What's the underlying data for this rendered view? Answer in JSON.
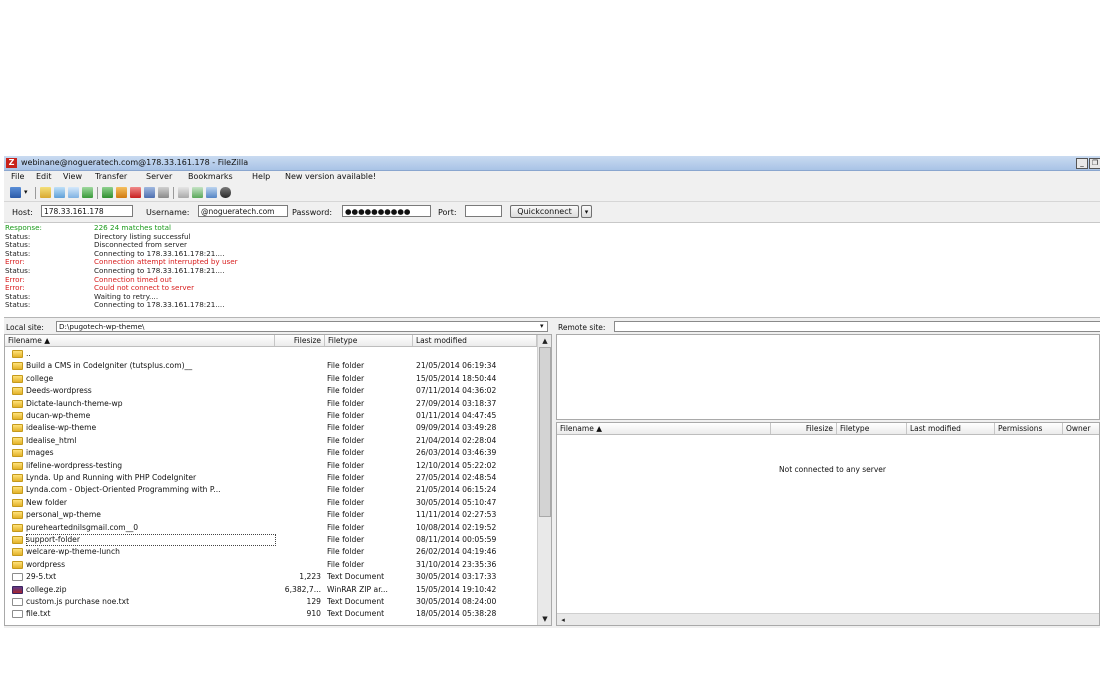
{
  "window": {
    "title": "webinane@nogueratech.com@178.33.161.178 - FileZilla",
    "app_icon": "filezilla-icon",
    "min_label": "_",
    "restore_label": "❐"
  },
  "menu": [
    "File",
    "Edit",
    "View",
    "Transfer",
    "Server",
    "Bookmarks",
    "Help",
    "New version available!"
  ],
  "quickconnect": {
    "host_label": "Host:",
    "host_value": "178.33.161.178",
    "username_label": "Username:",
    "username_value": "@nogueratech.com",
    "password_label": "Password:",
    "password_value": "●●●●●●●●●●",
    "port_label": "Port:",
    "port_value": "",
    "button_label": "Quickconnect",
    "dropdown_label": "▾"
  },
  "log": [
    {
      "k": "Response:",
      "v": "226 24 matches total",
      "color": "green"
    },
    {
      "k": "Status:",
      "v": "Directory listing successful",
      "color": "black"
    },
    {
      "k": "Status:",
      "v": "Disconnected from server",
      "color": "black"
    },
    {
      "k": "Status:",
      "v": "Connecting to 178.33.161.178:21....",
      "color": "black"
    },
    {
      "k": "Error:",
      "v": "Connection attempt interrupted by user",
      "color": "red"
    },
    {
      "k": "Status:",
      "v": "Connecting to 178.33.161.178:21....",
      "color": "black"
    },
    {
      "k": "Error:",
      "v": "Connection timed out",
      "color": "red"
    },
    {
      "k": "Error:",
      "v": "Could not connect to server",
      "color": "red"
    },
    {
      "k": "Status:",
      "v": "Waiting to retry....",
      "color": "black"
    },
    {
      "k": "Status:",
      "v": "Connecting to 178.33.161.178:21....",
      "color": "black"
    }
  ],
  "local": {
    "site_label": "Local site:",
    "path": "D:\\pugotech-wp-theme\\",
    "columns": {
      "name": "Filename ▲",
      "size": "Filesize",
      "type": "Filetype",
      "modified": "Last modified"
    },
    "files": [
      {
        "name": "..",
        "size": "",
        "type": "",
        "modified": "",
        "icon": "folder"
      },
      {
        "name": "Build a CMS in CodeIgniter (tutsplus.com)__",
        "size": "",
        "type": "File folder",
        "modified": "21/05/2014 06:19:34",
        "icon": "folder"
      },
      {
        "name": "college",
        "size": "",
        "type": "File folder",
        "modified": "15/05/2014 18:50:44",
        "icon": "folder"
      },
      {
        "name": "Deeds-wordpress",
        "size": "",
        "type": "File folder",
        "modified": "07/11/2014 04:36:02",
        "icon": "folder"
      },
      {
        "name": "Dictate-launch-theme-wp",
        "size": "",
        "type": "File folder",
        "modified": "27/09/2014 03:18:37",
        "icon": "folder"
      },
      {
        "name": "ducan-wp-theme",
        "size": "",
        "type": "File folder",
        "modified": "01/11/2014 04:47:45",
        "icon": "folder"
      },
      {
        "name": "idealise-wp-theme",
        "size": "",
        "type": "File folder",
        "modified": "09/09/2014 03:49:28",
        "icon": "folder"
      },
      {
        "name": "Idealise_html",
        "size": "",
        "type": "File folder",
        "modified": "21/04/2014 02:28:04",
        "icon": "folder"
      },
      {
        "name": "images",
        "size": "",
        "type": "File folder",
        "modified": "26/03/2014 03:46:39",
        "icon": "folder"
      },
      {
        "name": "lifeline-wordpress-testing",
        "size": "",
        "type": "File folder",
        "modified": "12/10/2014 05:22:02",
        "icon": "folder"
      },
      {
        "name": "Lynda. Up and Running with PHP CodeIgniter",
        "size": "",
        "type": "File folder",
        "modified": "27/05/2014 02:48:54",
        "icon": "folder"
      },
      {
        "name": "Lynda.com - Object-Oriented Programming with P...",
        "size": "",
        "type": "File folder",
        "modified": "21/05/2014 06:15:24",
        "icon": "folder"
      },
      {
        "name": "New folder",
        "size": "",
        "type": "File folder",
        "modified": "30/05/2014 05:10:47",
        "icon": "folder"
      },
      {
        "name": "personal_wp-theme",
        "size": "",
        "type": "File folder",
        "modified": "11/11/2014 02:27:53",
        "icon": "folder"
      },
      {
        "name": "pureheartednilsgmail.com__0",
        "size": "",
        "type": "File folder",
        "modified": "10/08/2014 02:19:52",
        "icon": "folder"
      },
      {
        "name": "support-folder",
        "size": "",
        "type": "File folder",
        "modified": "08/11/2014 00:05:59",
        "icon": "folder",
        "selected": true
      },
      {
        "name": "welcare-wp-theme-lunch",
        "size": "",
        "type": "File folder",
        "modified": "26/02/2014 04:19:46",
        "icon": "folder"
      },
      {
        "name": "wordpress",
        "size": "",
        "type": "File folder",
        "modified": "31/10/2014 23:35:36",
        "icon": "folder"
      },
      {
        "name": "29-5.txt",
        "size": "1,223",
        "type": "Text Document",
        "modified": "30/05/2014 03:17:33",
        "icon": "txt"
      },
      {
        "name": "college.zip",
        "size": "6,382,7...",
        "type": "WinRAR ZIP ar...",
        "modified": "15/05/2014 19:10:42",
        "icon": "zip"
      },
      {
        "name": "custom.js purchase noe.txt",
        "size": "129",
        "type": "Text Document",
        "modified": "30/05/2014 08:24:00",
        "icon": "txt"
      },
      {
        "name": "file.txt",
        "size": "910",
        "type": "Text Document",
        "modified": "18/05/2014 05:38:28",
        "icon": "txt"
      }
    ]
  },
  "remote": {
    "site_label": "Remote site:",
    "columns": {
      "name": "Filename ▲",
      "size": "Filesize",
      "type": "Filetype",
      "modified": "Last modified",
      "permissions": "Permissions",
      "owner": "Owner"
    },
    "empty_message": "Not connected to any server"
  }
}
